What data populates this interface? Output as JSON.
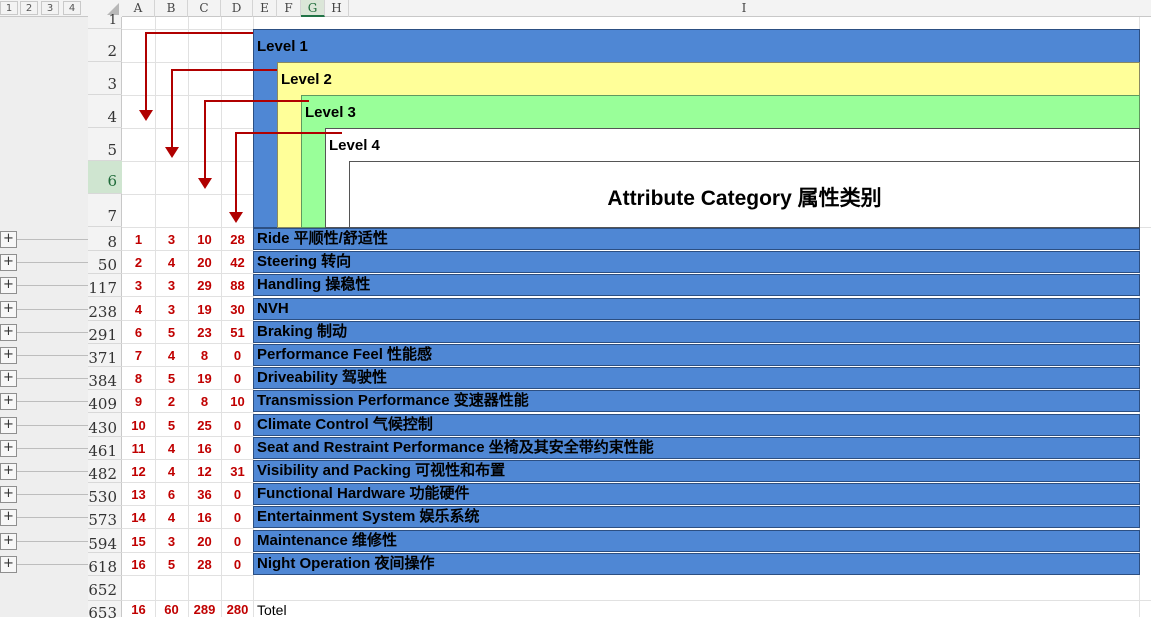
{
  "outline_levels": [
    "1",
    "2",
    "3",
    "4"
  ],
  "columns": [
    "A",
    "B",
    "C",
    "D",
    "E",
    "F",
    "G",
    "H",
    "I"
  ],
  "selected_column": "G",
  "header_rows": [
    "1",
    "2",
    "3",
    "4",
    "5",
    "6",
    "7"
  ],
  "selected_row": "6",
  "levels": {
    "level1": "Level 1",
    "level2": "Level 2",
    "level3": "Level 3",
    "level4": "Level 4"
  },
  "attribute_title": "Attribute Category  属性类别",
  "level_colors": {
    "level1": "#4f87d4",
    "level2": "#ffff99",
    "level3": "#99ff99",
    "level4": "#ffffff",
    "numbers": "#c00000",
    "arrows": "#b00000"
  },
  "categories": [
    {
      "row": "8",
      "a": "1",
      "b": "3",
      "c": "10",
      "d": "28",
      "label": "Ride 平顺性/舒适性"
    },
    {
      "row": "50",
      "a": "2",
      "b": "4",
      "c": "20",
      "d": "42",
      "label": "Steering 转向"
    },
    {
      "row": "117",
      "a": "3",
      "b": "3",
      "c": "29",
      "d": "88",
      "label": "Handling 操稳性"
    },
    {
      "row": "238",
      "a": "4",
      "b": "3",
      "c": "19",
      "d": "30",
      "label": "NVH"
    },
    {
      "row": "291",
      "a": "6",
      "b": "5",
      "c": "23",
      "d": "51",
      "label": "Braking 制动"
    },
    {
      "row": "371",
      "a": "7",
      "b": "4",
      "c": "8",
      "d": "0",
      "label": "Performance Feel 性能感"
    },
    {
      "row": "384",
      "a": "8",
      "b": "5",
      "c": "19",
      "d": "0",
      "label": "Driveability 驾驶性"
    },
    {
      "row": "409",
      "a": "9",
      "b": "2",
      "c": "8",
      "d": "10",
      "label": "Transmission Performance  变速器性能"
    },
    {
      "row": "430",
      "a": "10",
      "b": "5",
      "c": "25",
      "d": "0",
      "label": "Climate Control 气候控制"
    },
    {
      "row": "461",
      "a": "11",
      "b": "4",
      "c": "16",
      "d": "0",
      "label": "Seat and Restraint Performance 坐椅及其安全带约束性能"
    },
    {
      "row": "482",
      "a": "12",
      "b": "4",
      "c": "12",
      "d": "31",
      "label": "Visibility and Packing 可视性和布置"
    },
    {
      "row": "530",
      "a": "13",
      "b": "6",
      "c": "36",
      "d": "0",
      "label": "Functional Hardware 功能硬件"
    },
    {
      "row": "573",
      "a": "14",
      "b": "4",
      "c": "16",
      "d": "0",
      "label": "Entertainment System 娱乐系统"
    },
    {
      "row": "594",
      "a": "15",
      "b": "3",
      "c": "20",
      "d": "0",
      "label": "Maintenance  维修性"
    },
    {
      "row": "618",
      "a": "16",
      "b": "5",
      "c": "28",
      "d": "0",
      "label": "Night Operation 夜间操作"
    }
  ],
  "empty_row": "652",
  "total": {
    "row": "653",
    "a": "16",
    "b": "60",
    "c": "289",
    "d": "280",
    "label": "Totel"
  },
  "expand_symbol": "+"
}
